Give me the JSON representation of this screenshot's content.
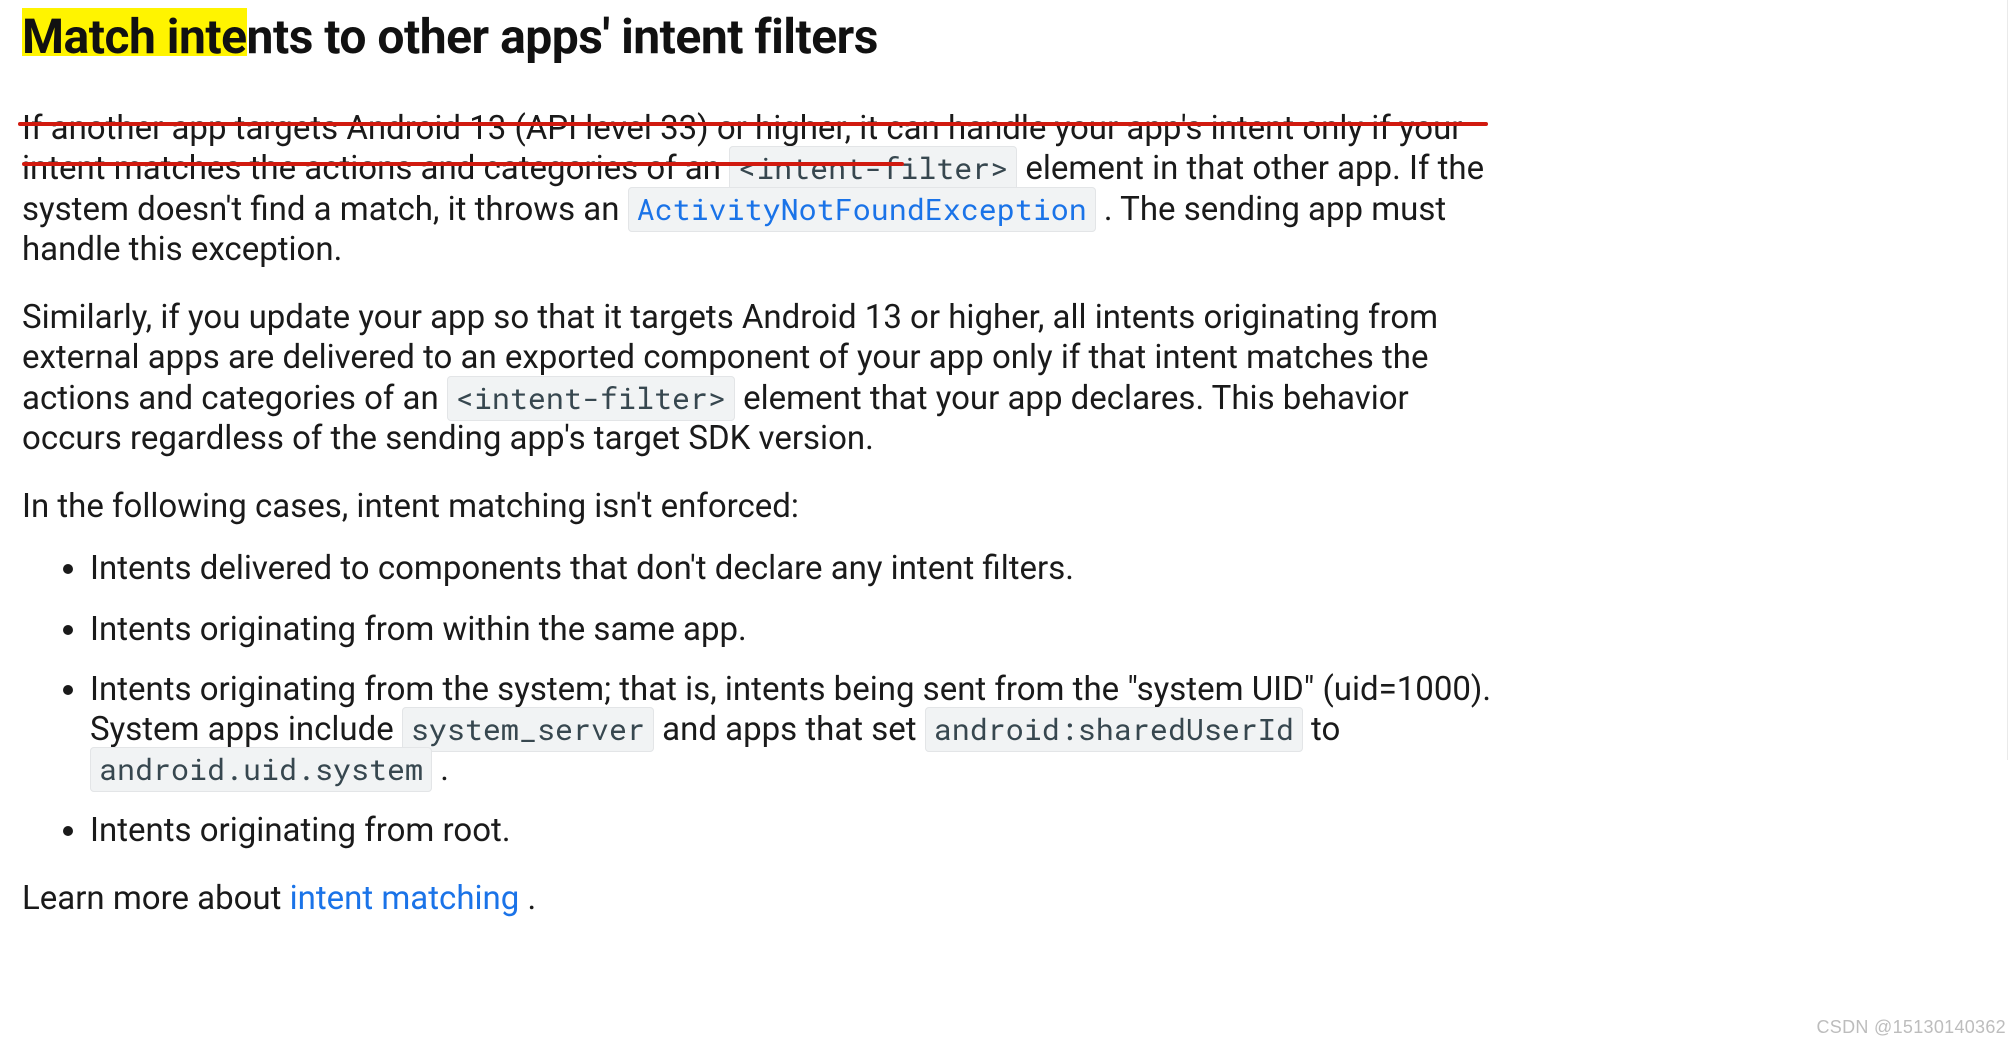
{
  "heading": "Match intents to other apps' intent filters",
  "p1": {
    "t_before_code1": "If another app targets Android 13 (API level 33) or higher, it can handle your app's intent only if your intent matches the actions and categories of an ",
    "code1": "<intent-filter>",
    "t_after_code1_before_link": " element in that other app. If the system doesn't find a match, it throws an ",
    "link_code": "ActivityNotFoundException",
    "t_after_link": ". The sending app must handle this exception."
  },
  "p2": {
    "t_before_code": "Similarly, if you update your app so that it targets Android 13 or higher, all intents originating from external apps are delivered to an exported component of your app only if that intent matches the actions and categories of an ",
    "code": "<intent-filter>",
    "t_after_code": " element that your app declares. This behavior occurs regardless of the sending app's target SDK version."
  },
  "p3": "In the following cases, intent matching isn't enforced:",
  "list": {
    "i1": "Intents delivered to components that don't declare any intent filters.",
    "i2": "Intents originating from within the same app.",
    "i3": {
      "a": "Intents originating from the system; that is, intents being sent from the \"system UID\" (uid=1000). System apps include ",
      "c1": "system_server",
      "b": " and apps that set ",
      "c2": "android:sharedUserId",
      "c": " to ",
      "c3": "android.uid.system",
      "d": "."
    },
    "i4": "Intents originating from root."
  },
  "p4": {
    "before_link": "Learn more about ",
    "link": "intent matching",
    "after_link": "."
  },
  "watermark": "CSDN @15130140362"
}
